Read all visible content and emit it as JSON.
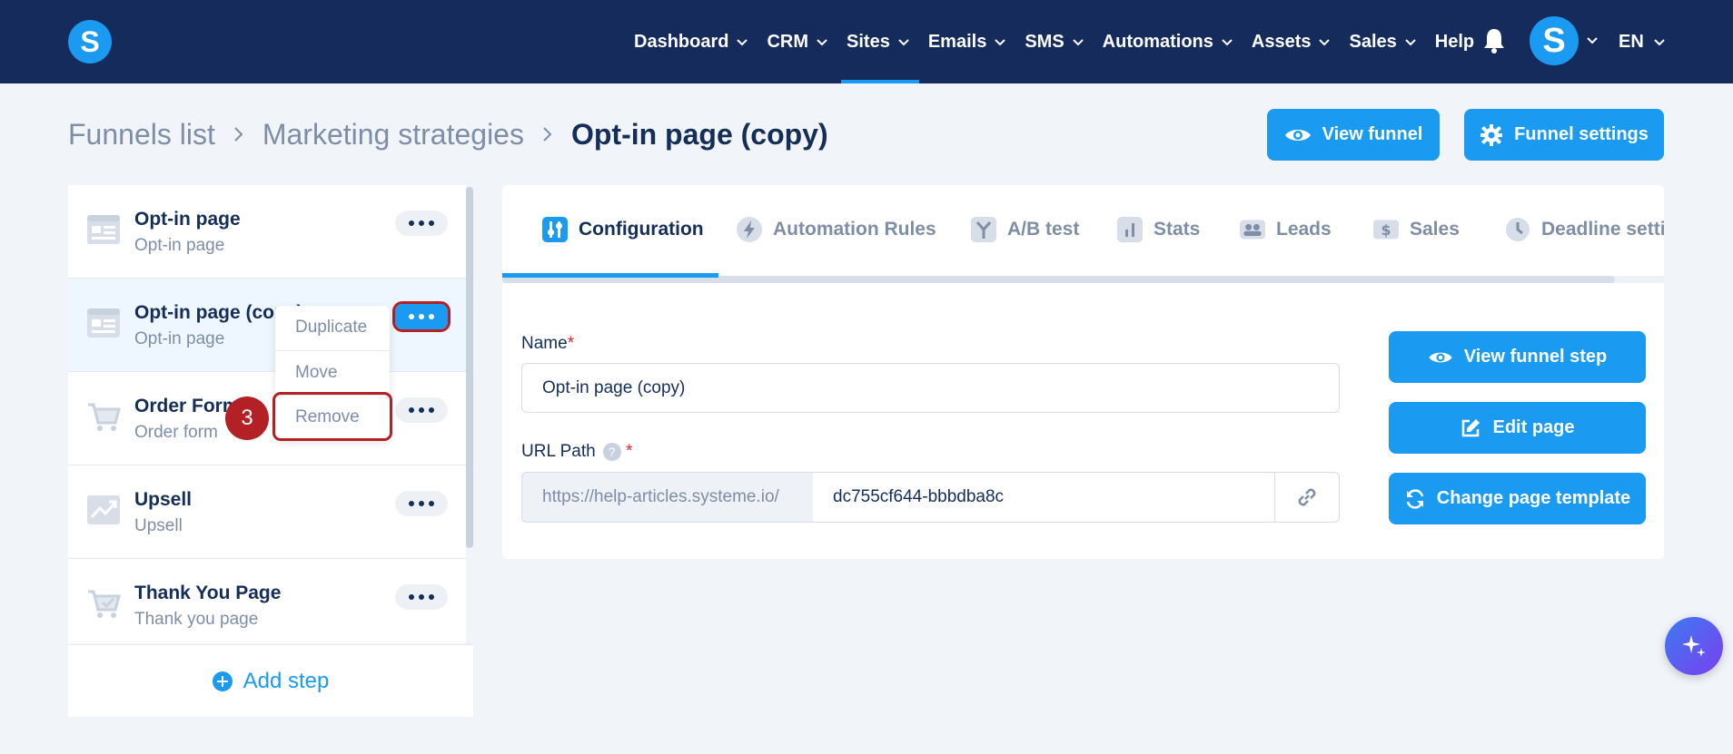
{
  "nav": {
    "logo": "S",
    "items": [
      {
        "label": "Dashboard",
        "chevron": true,
        "active": false
      },
      {
        "label": "CRM",
        "chevron": true,
        "active": false
      },
      {
        "label": "Sites",
        "chevron": true,
        "active": true
      },
      {
        "label": "Emails",
        "chevron": true,
        "active": false
      },
      {
        "label": "SMS",
        "chevron": true,
        "active": false
      },
      {
        "label": "Automations",
        "chevron": true,
        "active": false
      },
      {
        "label": "Assets",
        "chevron": true,
        "active": false
      },
      {
        "label": "Sales",
        "chevron": true,
        "active": false
      },
      {
        "label": "Help",
        "chevron": false,
        "active": false
      }
    ],
    "avatar": "S",
    "lang": "EN"
  },
  "breadcrumb": {
    "items": [
      "Funnels list",
      "Marketing strategies"
    ],
    "current": "Opt-in page (copy)"
  },
  "actions": {
    "view_funnel": "View funnel",
    "funnel_settings": "Funnel settings"
  },
  "steps": [
    {
      "title": "Opt-in page",
      "subtitle": "Opt-in page",
      "icon": "page-icon"
    },
    {
      "title": "Opt-in page (copy)",
      "subtitle": "Opt-in page",
      "icon": "page-icon"
    },
    {
      "title": "Order Form",
      "subtitle": "Order form",
      "icon": "cart-icon"
    },
    {
      "title": "Upsell",
      "subtitle": "Upsell",
      "icon": "chart-up-icon"
    },
    {
      "title": "Thank You Page",
      "subtitle": "Thank you page",
      "icon": "cart-check-icon"
    }
  ],
  "add_step": "Add step",
  "dropdown": {
    "items": [
      "Duplicate",
      "Move",
      "Remove"
    ]
  },
  "badge": "3",
  "tabs": [
    {
      "label": "Configuration",
      "icon": "sliders-icon"
    },
    {
      "label": "Automation Rules",
      "icon": "bolt-icon"
    },
    {
      "label": "A/B test",
      "icon": "split-icon"
    },
    {
      "label": "Stats",
      "icon": "stats-icon"
    },
    {
      "label": "Leads",
      "icon": "users-icon"
    },
    {
      "label": "Sales",
      "icon": "dollar-icon"
    },
    {
      "label": "Deadline setti",
      "icon": "clock-icon"
    }
  ],
  "form": {
    "name_label": "Name",
    "name_value": "Opt-in page (copy)",
    "url_label": "URL Path",
    "url_help": "?",
    "url_prefix": "https://help-articles.systeme.io/",
    "url_value": "dc755cf644-bbbdba8c",
    "required_mark": "*"
  },
  "side_actions": {
    "view_step": "View funnel step",
    "edit_page": "Edit page",
    "change_template": "Change page template"
  },
  "colors": {
    "nav_bg": "#152b5c",
    "accent": "#1a9af0",
    "highlight": "#b32025",
    "text": "#142e58",
    "muted": "#7e8ea7"
  }
}
